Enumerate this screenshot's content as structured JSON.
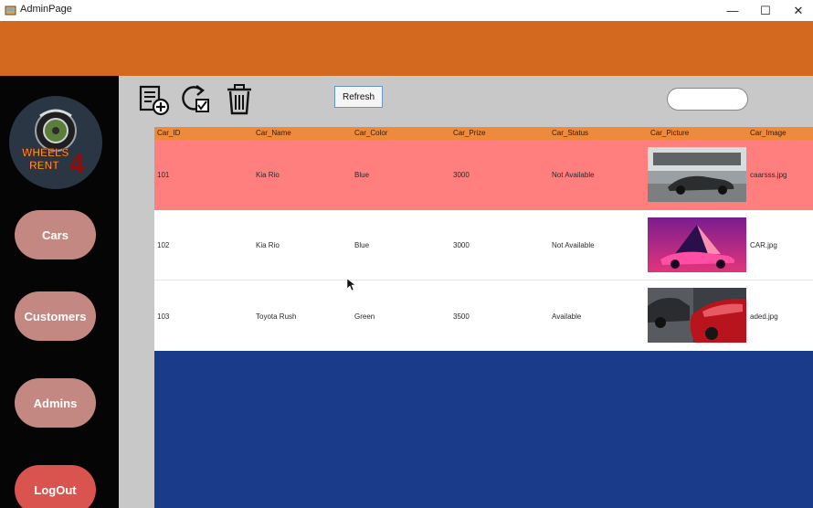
{
  "window": {
    "title": "AdminPage",
    "controls": {
      "minimize": "—",
      "maximize": "☐",
      "close": "✕"
    }
  },
  "sidebar": {
    "logo_text_line1": "WHEELS",
    "logo_text_line2": "RENT",
    "logo_text_number": "4",
    "buttons": [
      {
        "label": "Cars"
      },
      {
        "label": "Customers"
      },
      {
        "label": "Admins"
      },
      {
        "label": "LogOut"
      }
    ]
  },
  "toolbar": {
    "icons": [
      "add-document-icon",
      "refresh-check-icon",
      "trash-icon"
    ],
    "refresh_label": "Refresh",
    "search_value": ""
  },
  "grid": {
    "columns": [
      "Car_ID",
      "Car_Name",
      "Car_Color",
      "Car_Prize",
      "Car_Status",
      "Car_Picture",
      "Car_Image"
    ],
    "rows": [
      {
        "id": "101",
        "name": "Kia Rio",
        "color": "Blue",
        "prize": "3000",
        "status": "Not Available",
        "image": "caarsss.jpg"
      },
      {
        "id": "102",
        "name": "Kia Rio",
        "color": "Blue",
        "prize": "3000",
        "status": "Not Available",
        "image": "CAR.jpg"
      },
      {
        "id": "103",
        "name": "Toyota Rush",
        "color": "Green",
        "prize": "3500",
        "status": "Available",
        "image": "aded.jpg"
      }
    ]
  },
  "colors": {
    "header": "#d2691e",
    "sidebar": "#050505",
    "side_button": "#c48883",
    "logout_button": "#d9534f",
    "grid_header": "#ee8a3c",
    "selected_row": "#ff7f7f",
    "grid_background": "#1a3a8a"
  }
}
